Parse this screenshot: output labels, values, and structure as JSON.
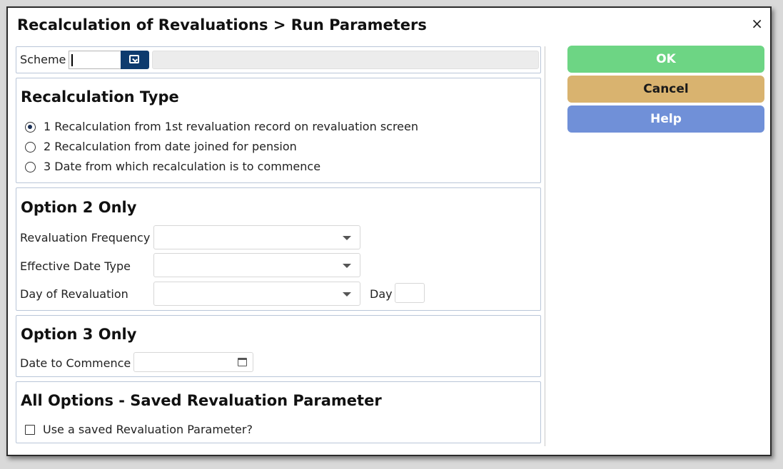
{
  "dialog": {
    "title": "Recalculation of Revaluations > Run Parameters",
    "close_label": "×"
  },
  "scheme": {
    "label": "Scheme",
    "value": "",
    "description": ""
  },
  "recalc_type": {
    "heading": "Recalculation Type",
    "options": [
      {
        "label": "1 Recalculation from 1st revaluation record on revaluation screen",
        "selected": true
      },
      {
        "label": "2 Recalculation from date joined for pension",
        "selected": false
      },
      {
        "label": "3 Date from which recalculation is to commence",
        "selected": false
      }
    ]
  },
  "option2": {
    "heading": "Option 2 Only",
    "revaluation_frequency_label": "Revaluation Frequency",
    "effective_date_type_label": "Effective Date Type",
    "day_of_revaluation_label": "Day of Revaluation",
    "day_label": "Day",
    "revaluation_frequency_value": "",
    "effective_date_type_value": "",
    "day_of_revaluation_value": "",
    "day_value": ""
  },
  "option3": {
    "heading": "Option 3 Only",
    "date_to_commence_label": "Date to Commence",
    "date_to_commence_value": ""
  },
  "all_options": {
    "heading": "All Options - Saved Revaluation Parameter",
    "checkbox_label": "Use a saved Revaluation Parameter?",
    "checked": false
  },
  "buttons": {
    "ok": {
      "label": "OK",
      "color": "#6dd584"
    },
    "cancel": {
      "label": "Cancel",
      "color": "#d9b36f"
    },
    "help": {
      "label": "Help",
      "color": "#7090d8"
    }
  }
}
